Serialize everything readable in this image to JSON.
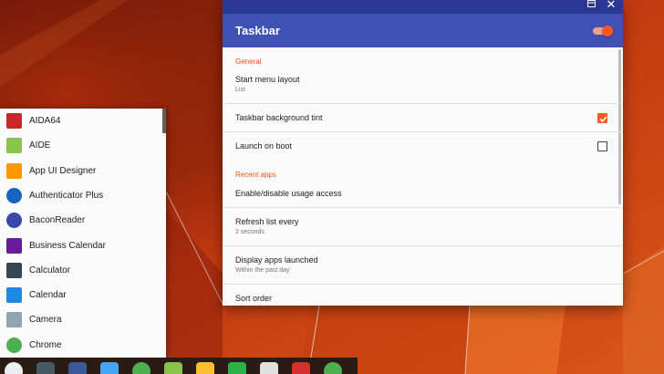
{
  "window": {
    "title": "Taskbar",
    "icons": {
      "maximize": "maximize-icon",
      "close": "close-icon"
    },
    "close_glyph": "✕",
    "enabled": true,
    "accent": "#ff5722",
    "header_color": "#3f51b5"
  },
  "settings": {
    "general_header": "General",
    "start_menu_layout": {
      "title": "Start menu layout",
      "summary": "List"
    },
    "background_tint": {
      "title": "Taskbar background tint",
      "checked": true
    },
    "launch_on_boot": {
      "title": "Launch on boot",
      "checked": false
    },
    "recent_apps_header": "Recent apps",
    "usage_access": {
      "title": "Enable/disable usage access"
    },
    "refresh_list": {
      "title": "Refresh list every",
      "summary": "2 seconds"
    },
    "display_apps": {
      "title": "Display apps launched",
      "summary": "Within the past day"
    },
    "sort_order": {
      "title": "Sort order"
    }
  },
  "apps": [
    {
      "label": "AIDA64",
      "icon": "aida64-icon",
      "color": "#c62828"
    },
    {
      "label": "AIDE",
      "icon": "aide-icon",
      "color": "#8bc34a"
    },
    {
      "label": "App UI Designer",
      "icon": "app-ui-designer-icon",
      "color": "#ff9800"
    },
    {
      "label": "Authenticator Plus",
      "icon": "authenticator-plus-icon",
      "color": "#1565c0"
    },
    {
      "label": "BaconReader",
      "icon": "baconreader-icon",
      "color": "#3949ab"
    },
    {
      "label": "Business Calendar",
      "icon": "business-calendar-icon",
      "color": "#6a1b9a"
    },
    {
      "label": "Calculator",
      "icon": "calculator-icon",
      "color": "#37474f"
    },
    {
      "label": "Calendar",
      "icon": "calendar-icon",
      "color": "#1e88e5"
    },
    {
      "label": "Camera",
      "icon": "camera-icon",
      "color": "#90a4ae"
    },
    {
      "label": "Chrome",
      "icon": "chrome-icon",
      "color": "#4caf50"
    }
  ],
  "taskbar": {
    "icons": [
      {
        "name": "start-menu-icon",
        "color": "#eceff1"
      },
      {
        "name": "settings-app-icon",
        "color": "#455a64"
      },
      {
        "name": "facebook-icon",
        "color": "#3b5998"
      },
      {
        "name": "docs-app-icon",
        "color": "#42a5f5"
      },
      {
        "name": "pushbullet-icon",
        "color": "#4caf50"
      },
      {
        "name": "android-app-icon",
        "color": "#8bc34a"
      },
      {
        "name": "drive-icon",
        "color": "#fbc02d"
      },
      {
        "name": "feedly-icon",
        "color": "#2bb24c"
      },
      {
        "name": "play-store-icon",
        "color": "#e0e0e0"
      },
      {
        "name": "gmail-icon",
        "color": "#d32f2f"
      },
      {
        "name": "chrome-taskbar-icon",
        "color": "#4caf50"
      }
    ]
  }
}
